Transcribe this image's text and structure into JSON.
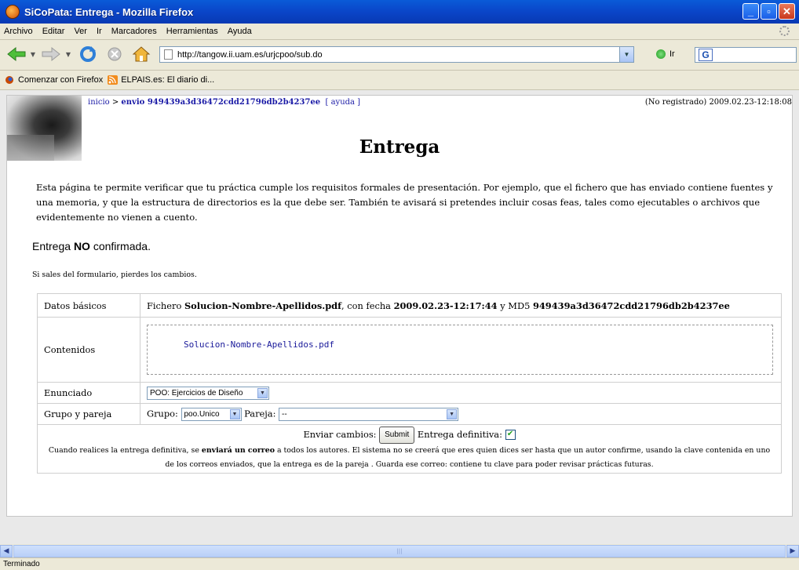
{
  "window": {
    "title": "SiCoPata: Entrega - Mozilla Firefox"
  },
  "menu": [
    "Archivo",
    "Editar",
    "Ver",
    "Ir",
    "Marcadores",
    "Herramientas",
    "Ayuda"
  ],
  "nav": {
    "url": "http://tangow.ii.uam.es/urjcpoo/sub.do",
    "go_label": "Ir",
    "search_engine_icon": "google-icon"
  },
  "bookmarks": [
    "Comenzar con Firefox",
    "ELPAIS.es: El diario di..."
  ],
  "page": {
    "crumb_home": "inicio",
    "crumb_sep": ">",
    "crumb_current": "envio 949439a3d36472cdd21796db2b4237ee",
    "help_link": "[ ayuda ]",
    "user_status": "(No registrado) 2009.02.23-12:18:08",
    "heading": "Entrega",
    "intro": "Esta página te permite verificar que tu práctica cumple los requisitos formales de presentación. Por ejemplo, que el fichero que has enviado contiene fuentes y una memoria, y que la estructura de directorios es la que debe ser. También te avisará si pretendes incluir cosas feas, tales como ejecutables o archivos que evidentemente no vienen a cuento.",
    "state_prefix": "Entrega ",
    "state_bold": "NO",
    "state_suffix": " confirmada.",
    "leave_warning": "Si sales del formulario, pierdes los cambios."
  },
  "form": {
    "basic": {
      "label": "Datos básicos",
      "prefix": "Fichero ",
      "filename": "Solucion-Nombre-Apellidos.pdf",
      "date_text": ", con fecha ",
      "date": "2009.02.23-12:17:44",
      "md5_text": " y MD5 ",
      "md5": "949439a3d36472cdd21796db2b4237ee"
    },
    "contents": {
      "label": "Contenidos",
      "file": "Solucion-Nombre-Apellidos.pdf"
    },
    "statement": {
      "label": "Enunciado",
      "selected": "POO: Ejercicios de Diseño"
    },
    "group": {
      "label": "Grupo y pareja",
      "group_label": "Grupo:",
      "group_selected": "poo.Unico",
      "pair_label": "Pareja:",
      "pair_selected": "--"
    },
    "submit": {
      "send_label": "Enviar cambios:",
      "button": "Submit",
      "final_label": "Entrega definitiva:",
      "final_checked": true,
      "note_a": "Cuando realices la entrega definitiva, se ",
      "note_bold": "enviará un correo",
      "note_b": " a todos los autores. El sistema no se creerá que eres quien dices ser hasta que un autor confirme, usando la clave contenida en uno de los correos enviados, que la entrega es de la pareja . Guarda ese correo: contiene tu clave para poder revisar prácticas futuras."
    }
  },
  "statusbar": {
    "text": "Terminado"
  },
  "colors": {
    "titlebar": "#0a45c8",
    "link": "#1a1aa6",
    "chrome": "#ece9d8"
  }
}
